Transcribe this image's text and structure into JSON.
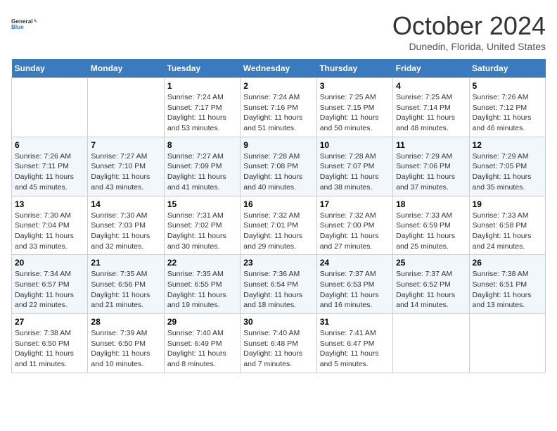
{
  "header": {
    "logo_line1": "General",
    "logo_line2": "Blue",
    "month_title": "October 2024",
    "subtitle": "Dunedin, Florida, United States"
  },
  "days_of_week": [
    "Sunday",
    "Monday",
    "Tuesday",
    "Wednesday",
    "Thursday",
    "Friday",
    "Saturday"
  ],
  "weeks": [
    [
      {
        "day": "",
        "sunrise": "",
        "sunset": "",
        "daylight": ""
      },
      {
        "day": "",
        "sunrise": "",
        "sunset": "",
        "daylight": ""
      },
      {
        "day": "1",
        "sunrise": "Sunrise: 7:24 AM",
        "sunset": "Sunset: 7:17 PM",
        "daylight": "Daylight: 11 hours and 53 minutes."
      },
      {
        "day": "2",
        "sunrise": "Sunrise: 7:24 AM",
        "sunset": "Sunset: 7:16 PM",
        "daylight": "Daylight: 11 hours and 51 minutes."
      },
      {
        "day": "3",
        "sunrise": "Sunrise: 7:25 AM",
        "sunset": "Sunset: 7:15 PM",
        "daylight": "Daylight: 11 hours and 50 minutes."
      },
      {
        "day": "4",
        "sunrise": "Sunrise: 7:25 AM",
        "sunset": "Sunset: 7:14 PM",
        "daylight": "Daylight: 11 hours and 48 minutes."
      },
      {
        "day": "5",
        "sunrise": "Sunrise: 7:26 AM",
        "sunset": "Sunset: 7:12 PM",
        "daylight": "Daylight: 11 hours and 46 minutes."
      }
    ],
    [
      {
        "day": "6",
        "sunrise": "Sunrise: 7:26 AM",
        "sunset": "Sunset: 7:11 PM",
        "daylight": "Daylight: 11 hours and 45 minutes."
      },
      {
        "day": "7",
        "sunrise": "Sunrise: 7:27 AM",
        "sunset": "Sunset: 7:10 PM",
        "daylight": "Daylight: 11 hours and 43 minutes."
      },
      {
        "day": "8",
        "sunrise": "Sunrise: 7:27 AM",
        "sunset": "Sunset: 7:09 PM",
        "daylight": "Daylight: 11 hours and 41 minutes."
      },
      {
        "day": "9",
        "sunrise": "Sunrise: 7:28 AM",
        "sunset": "Sunset: 7:08 PM",
        "daylight": "Daylight: 11 hours and 40 minutes."
      },
      {
        "day": "10",
        "sunrise": "Sunrise: 7:28 AM",
        "sunset": "Sunset: 7:07 PM",
        "daylight": "Daylight: 11 hours and 38 minutes."
      },
      {
        "day": "11",
        "sunrise": "Sunrise: 7:29 AM",
        "sunset": "Sunset: 7:06 PM",
        "daylight": "Daylight: 11 hours and 37 minutes."
      },
      {
        "day": "12",
        "sunrise": "Sunrise: 7:29 AM",
        "sunset": "Sunset: 7:05 PM",
        "daylight": "Daylight: 11 hours and 35 minutes."
      }
    ],
    [
      {
        "day": "13",
        "sunrise": "Sunrise: 7:30 AM",
        "sunset": "Sunset: 7:04 PM",
        "daylight": "Daylight: 11 hours and 33 minutes."
      },
      {
        "day": "14",
        "sunrise": "Sunrise: 7:30 AM",
        "sunset": "Sunset: 7:03 PM",
        "daylight": "Daylight: 11 hours and 32 minutes."
      },
      {
        "day": "15",
        "sunrise": "Sunrise: 7:31 AM",
        "sunset": "Sunset: 7:02 PM",
        "daylight": "Daylight: 11 hours and 30 minutes."
      },
      {
        "day": "16",
        "sunrise": "Sunrise: 7:32 AM",
        "sunset": "Sunset: 7:01 PM",
        "daylight": "Daylight: 11 hours and 29 minutes."
      },
      {
        "day": "17",
        "sunrise": "Sunrise: 7:32 AM",
        "sunset": "Sunset: 7:00 PM",
        "daylight": "Daylight: 11 hours and 27 minutes."
      },
      {
        "day": "18",
        "sunrise": "Sunrise: 7:33 AM",
        "sunset": "Sunset: 6:59 PM",
        "daylight": "Daylight: 11 hours and 25 minutes."
      },
      {
        "day": "19",
        "sunrise": "Sunrise: 7:33 AM",
        "sunset": "Sunset: 6:58 PM",
        "daylight": "Daylight: 11 hours and 24 minutes."
      }
    ],
    [
      {
        "day": "20",
        "sunrise": "Sunrise: 7:34 AM",
        "sunset": "Sunset: 6:57 PM",
        "daylight": "Daylight: 11 hours and 22 minutes."
      },
      {
        "day": "21",
        "sunrise": "Sunrise: 7:35 AM",
        "sunset": "Sunset: 6:56 PM",
        "daylight": "Daylight: 11 hours and 21 minutes."
      },
      {
        "day": "22",
        "sunrise": "Sunrise: 7:35 AM",
        "sunset": "Sunset: 6:55 PM",
        "daylight": "Daylight: 11 hours and 19 minutes."
      },
      {
        "day": "23",
        "sunrise": "Sunrise: 7:36 AM",
        "sunset": "Sunset: 6:54 PM",
        "daylight": "Daylight: 11 hours and 18 minutes."
      },
      {
        "day": "24",
        "sunrise": "Sunrise: 7:37 AM",
        "sunset": "Sunset: 6:53 PM",
        "daylight": "Daylight: 11 hours and 16 minutes."
      },
      {
        "day": "25",
        "sunrise": "Sunrise: 7:37 AM",
        "sunset": "Sunset: 6:52 PM",
        "daylight": "Daylight: 11 hours and 14 minutes."
      },
      {
        "day": "26",
        "sunrise": "Sunrise: 7:38 AM",
        "sunset": "Sunset: 6:51 PM",
        "daylight": "Daylight: 11 hours and 13 minutes."
      }
    ],
    [
      {
        "day": "27",
        "sunrise": "Sunrise: 7:38 AM",
        "sunset": "Sunset: 6:50 PM",
        "daylight": "Daylight: 11 hours and 11 minutes."
      },
      {
        "day": "28",
        "sunrise": "Sunrise: 7:39 AM",
        "sunset": "Sunset: 6:50 PM",
        "daylight": "Daylight: 11 hours and 10 minutes."
      },
      {
        "day": "29",
        "sunrise": "Sunrise: 7:40 AM",
        "sunset": "Sunset: 6:49 PM",
        "daylight": "Daylight: 11 hours and 8 minutes."
      },
      {
        "day": "30",
        "sunrise": "Sunrise: 7:40 AM",
        "sunset": "Sunset: 6:48 PM",
        "daylight": "Daylight: 11 hours and 7 minutes."
      },
      {
        "day": "31",
        "sunrise": "Sunrise: 7:41 AM",
        "sunset": "Sunset: 6:47 PM",
        "daylight": "Daylight: 11 hours and 5 minutes."
      },
      {
        "day": "",
        "sunrise": "",
        "sunset": "",
        "daylight": ""
      },
      {
        "day": "",
        "sunrise": "",
        "sunset": "",
        "daylight": ""
      }
    ]
  ]
}
